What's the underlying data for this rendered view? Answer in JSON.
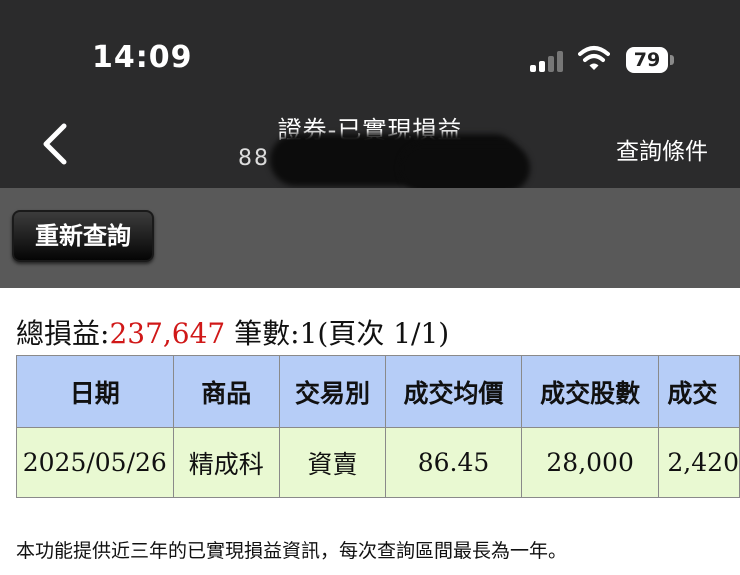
{
  "status_bar": {
    "time": "14:09",
    "battery": "79"
  },
  "nav": {
    "title": "證券-已實現損益",
    "account": "88  ****4",
    "query_conditions": "查詢條件"
  },
  "toolbar": {
    "requery_label": "重新查詢"
  },
  "summary": {
    "total_label": "總損益:",
    "total_value": "237,647",
    "count_label": "筆數:",
    "count_value": "1(頁次 1/1)"
  },
  "table": {
    "headers": [
      "日期",
      "商品",
      "交易別",
      "成交均價",
      "成交股數",
      "成交"
    ],
    "rows": [
      {
        "date": "2025/05/26",
        "product": "精成科",
        "trade_type": "資賣",
        "avg_price": "86.45",
        "shares": "28,000",
        "amount": "2,420"
      }
    ]
  },
  "footer_note": "本功能提供近三年的已實現損益資訊，每次查詢區間最長為一年。",
  "colors": {
    "header_bg": "#b6cdf7",
    "row_bg": "#e9f9d2",
    "profit_red": "#d01818",
    "link_blue": "#1f28d6"
  }
}
